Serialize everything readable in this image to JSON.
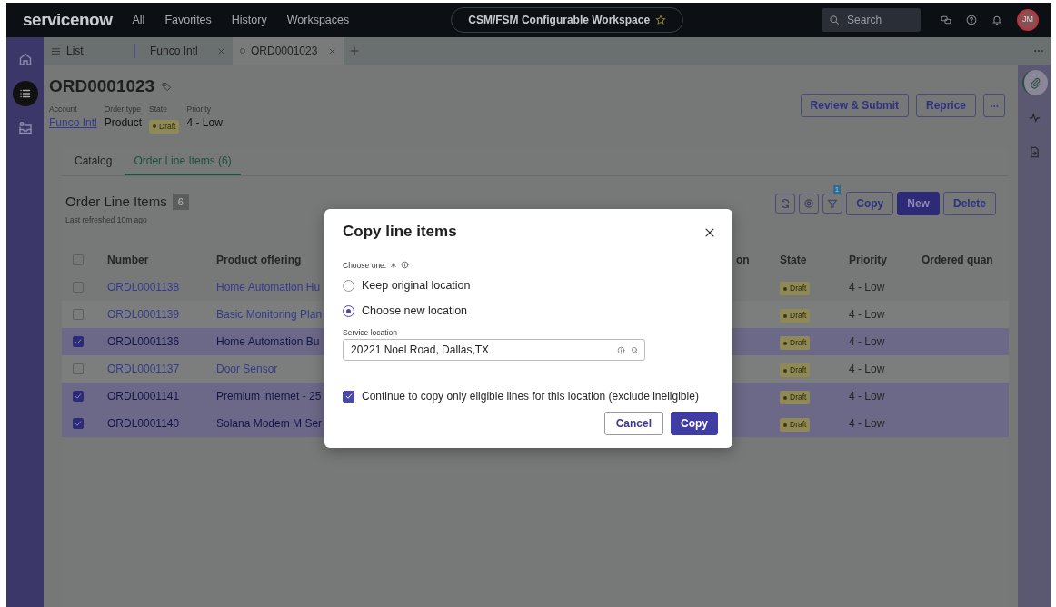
{
  "topbar": {
    "logo": "servicenow",
    "nav": [
      "All",
      "Favorites",
      "History",
      "Workspaces"
    ],
    "workspace": "CSM/FSM Configurable Workspace",
    "search": {
      "placeholder": "Search"
    },
    "avatar": "JM"
  },
  "rail": [
    {
      "kind": "home",
      "selected": false
    },
    {
      "kind": "list",
      "selected": true
    },
    {
      "kind": "inbox",
      "selected": false
    }
  ],
  "tabs": [
    {
      "kind": "list",
      "label": "List",
      "selected": false
    },
    {
      "kind": "record",
      "label": "Funco Intl",
      "selected": false
    },
    {
      "kind": "record",
      "label": "ORD0001023",
      "selected": true
    }
  ],
  "record": {
    "title": "ORD0001023",
    "fields": [
      {
        "label": "Account",
        "value": "Funco Intl",
        "kind": "link"
      },
      {
        "label": "Order type",
        "value": "Product",
        "kind": "text"
      },
      {
        "label": "State",
        "value": "Draft",
        "kind": "badge"
      },
      {
        "label": "Priority",
        "value": "4 - Low",
        "kind": "text"
      }
    ],
    "actions": [
      "Review & Submit",
      "Reprice"
    ]
  },
  "subtabs": [
    {
      "label": "Catalog",
      "selected": false
    },
    {
      "label": "Order Line Items (6)",
      "selected": true
    }
  ],
  "list": {
    "title": "Order Line Items",
    "count": "6",
    "refreshed": "Last refreshed 10m ago",
    "filter_count": "1",
    "buttons": [
      {
        "label": "Copy",
        "kind": "outline"
      },
      {
        "label": "New",
        "kind": "primary"
      },
      {
        "label": "Delete",
        "kind": "outline"
      }
    ],
    "header_checked": false,
    "columns": [
      "Number",
      "Product offering",
      "on",
      "State",
      "Priority",
      "Ordered quan"
    ],
    "rows": [
      {
        "selected": false,
        "number": "ORDL0001138",
        "product": "Home Automation Hu",
        "state": "Draft",
        "priority": "4 - Low"
      },
      {
        "selected": false,
        "number": "ORDL0001139",
        "product": "Basic Monitoring Plan",
        "state": "Draft",
        "priority": "4 - Low"
      },
      {
        "selected": true,
        "number": "ORDL0001136",
        "product": "Home Automation Bu",
        "state": "Draft",
        "priority": "4 - Low"
      },
      {
        "selected": false,
        "number": "ORDL0001137",
        "product": "Door Sensor",
        "state": "Draft",
        "priority": "4 - Low"
      },
      {
        "selected": true,
        "number": "ORDL0001141",
        "product": "Premium internet - 25",
        "state": "Draft",
        "priority": "4 - Low"
      },
      {
        "selected": true,
        "number": "ORDL0001140",
        "product": "Solana Modem M Ser",
        "state": "Draft",
        "priority": "4 - Low"
      }
    ]
  },
  "side_panel": [
    {
      "kind": "attachment",
      "selected": true
    },
    {
      "kind": "activity",
      "selected": false
    },
    {
      "kind": "document",
      "selected": false
    }
  ],
  "dialog": {
    "title": "Copy line items",
    "prompt": "Choose one:",
    "options": [
      {
        "label": "Keep original location",
        "selected": false
      },
      {
        "label": "Choose new location",
        "selected": true
      }
    ],
    "field": {
      "label": "Service location",
      "value": "20221 Noel Road, Dallas,TX"
    },
    "eligible": {
      "label": "Continue to copy only eligible lines for this location (exclude ineligible)",
      "checked": true
    },
    "buttons": [
      {
        "label": "Cancel",
        "kind": "outline"
      },
      {
        "label": "Copy",
        "kind": "primary"
      }
    ]
  }
}
